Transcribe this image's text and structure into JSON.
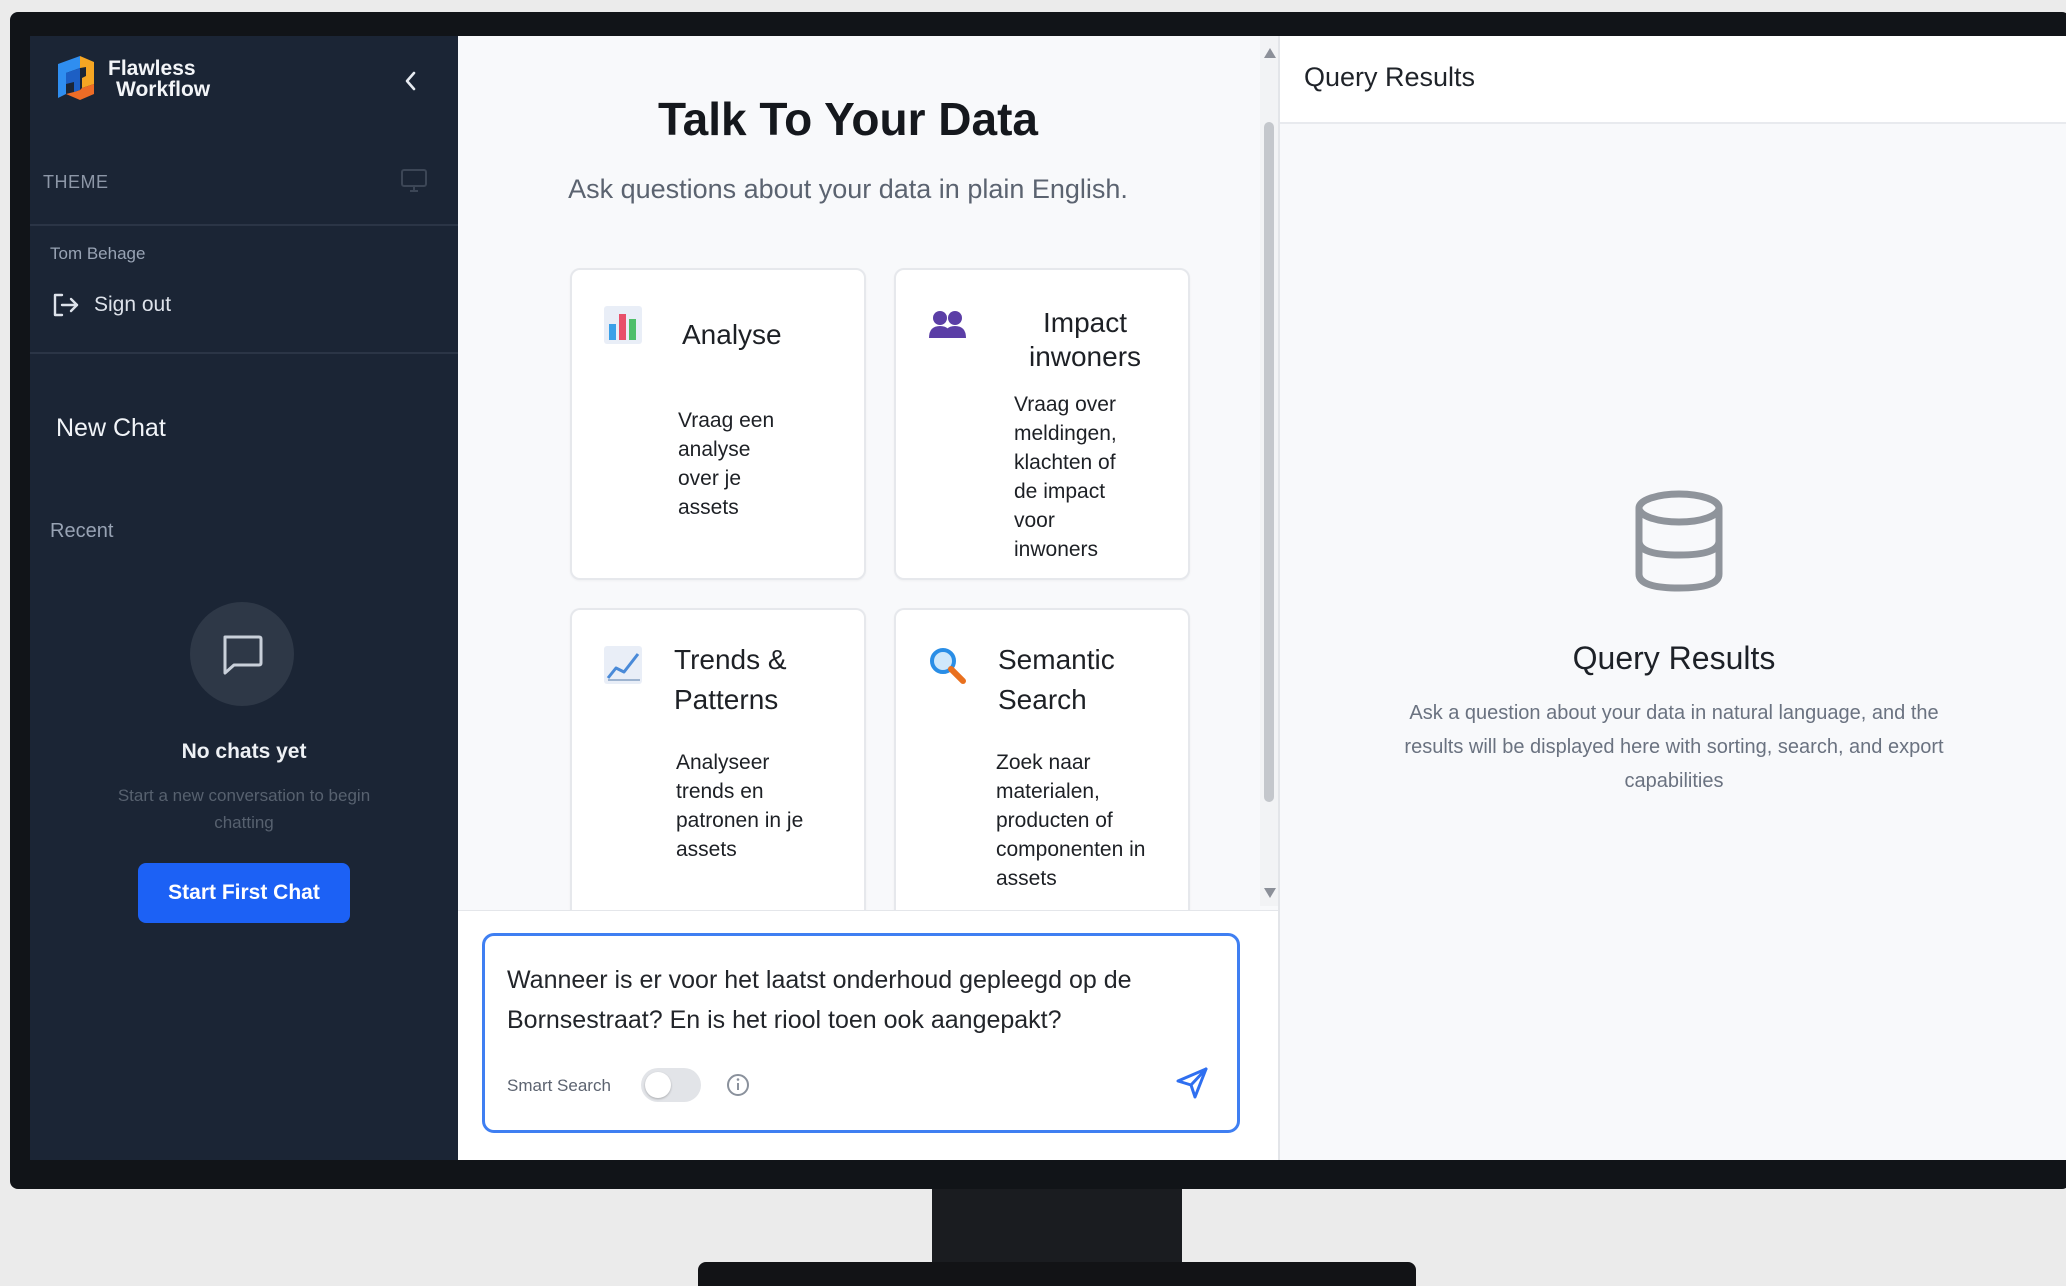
{
  "sidebar": {
    "brand_line1": "Flawless",
    "brand_line2": "Workflow",
    "theme_label": "THEME",
    "user_name": "Tom Behage",
    "sign_out": "Sign out",
    "new_chat": "New Chat",
    "recent_label": "Recent",
    "empty_title": "No chats yet",
    "empty_subtitle": "Start a new conversation to begin chatting",
    "start_button": "Start First Chat"
  },
  "main": {
    "title": "Talk To Your Data",
    "subtitle": "Ask questions about your data in plain English.",
    "cards": [
      {
        "icon": "bar-chart-icon",
        "title": "Analyse",
        "description": "Vraag een analyse over je assets"
      },
      {
        "icon": "people-icon",
        "title": "Impact inwoners",
        "description": "Vraag over meldingen, klachten of de impact voor inwoners"
      },
      {
        "icon": "trend-chart-icon",
        "title": "Trends & Patterns",
        "description": "Analyseer trends en patronen in je assets"
      },
      {
        "icon": "magnifier-icon",
        "title": "Semantic Search",
        "description": "Zoek naar materialen, producten of componenten in assets"
      }
    ],
    "input_text": "Wanneer is er voor het laatst onderhoud gepleegd op de Bornsestraat? En is het riool toen ook aangepakt?",
    "smart_search_label": "Smart Search",
    "smart_search_enabled": false
  },
  "results": {
    "header": "Query Results",
    "empty_title": "Query Results",
    "empty_description": "Ask a question about your data in natural language, and the results will be displayed here with sorting, search, and export capabilities"
  },
  "colors": {
    "sidebar_bg": "#1b2535",
    "accent_blue": "#1c61f5",
    "input_border": "#3f7ff2"
  }
}
